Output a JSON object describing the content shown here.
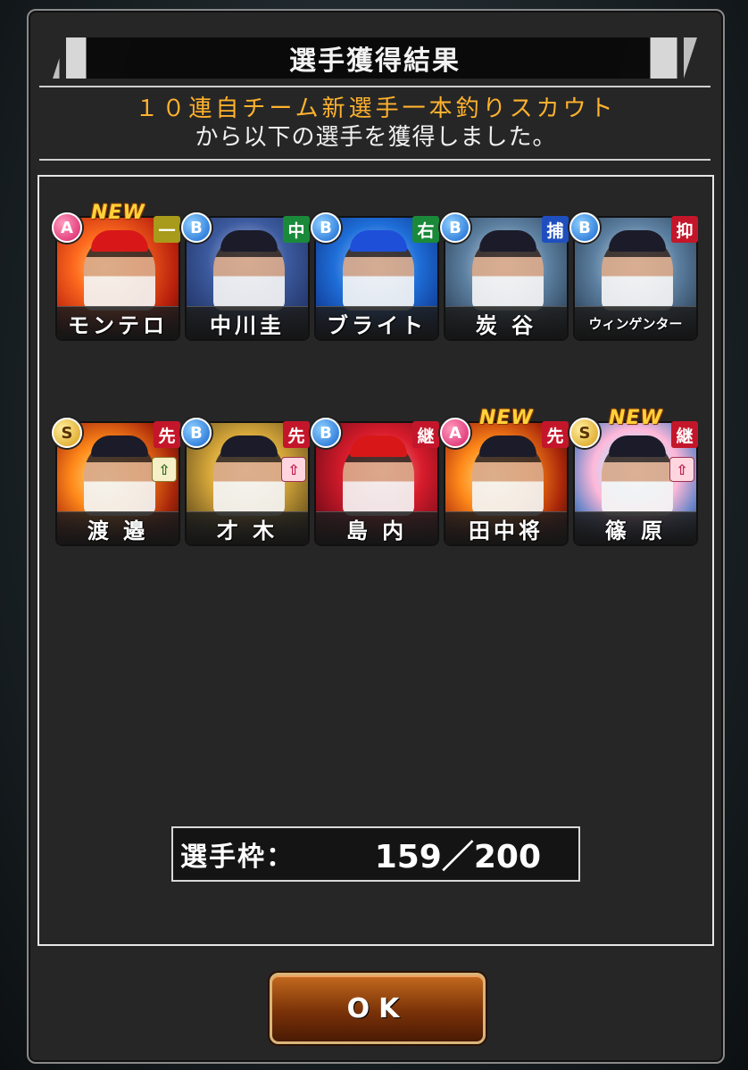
{
  "title": "選手獲得結果",
  "message": {
    "line1": "１０連自チーム新選手一本釣りスカウト",
    "line2": "から以下の選手を獲得しました。"
  },
  "players": [
    {
      "name": "モンテロ",
      "rank": "A",
      "position": "一",
      "new": "NEW"
    },
    {
      "name": "中川圭",
      "rank": "B",
      "position": "中",
      "new": ""
    },
    {
      "name": "ブライト",
      "rank": "B",
      "position": "右",
      "new": ""
    },
    {
      "name": "炭 谷",
      "rank": "B",
      "position": "捕",
      "new": ""
    },
    {
      "name": "ウィンゲンター",
      "rank": "B",
      "position": "抑",
      "new": ""
    },
    {
      "name": "渡 邉",
      "rank": "S",
      "position": "先",
      "new": ""
    },
    {
      "name": "才 木",
      "rank": "B",
      "position": "先",
      "new": ""
    },
    {
      "name": "島 内",
      "rank": "B",
      "position": "継",
      "new": ""
    },
    {
      "name": "田中将",
      "rank": "A",
      "position": "先",
      "new": "NEW"
    },
    {
      "name": "篠 原",
      "rank": "S",
      "position": "継",
      "new": "NEW"
    }
  ],
  "slot": {
    "label": "選手枠：",
    "value": "159／200"
  },
  "ok_label": "OK",
  "colors": {
    "accent_text": "#ffb22e",
    "button": "#7a3208"
  }
}
